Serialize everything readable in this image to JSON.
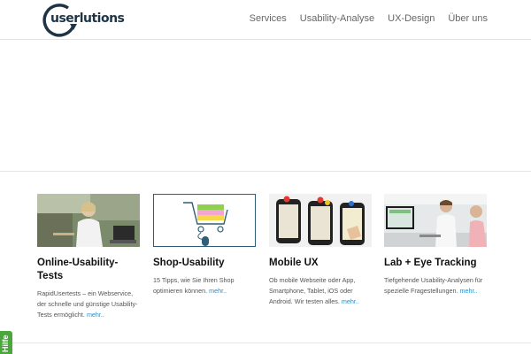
{
  "header": {
    "logo_text": "userlutions",
    "nav": [
      "Services",
      "Usability-Analyse",
      "UX-Design",
      "Über uns"
    ]
  },
  "features": [
    {
      "title": "Online-Usability-Tests",
      "desc": "RapidUsertests – ein Webservice, der schnelle und günstige Usability-Tests ermöglicht.",
      "more": "mehr..",
      "image": "person-with-laptop-outdoors"
    },
    {
      "title": "Shop-Usability",
      "desc": "15 Tipps, wie Sie Ihren Shop optimieren können.",
      "more": "mehr..",
      "image": "shopping-cart-illustration"
    },
    {
      "title": "Mobile UX",
      "desc": "Ob mobile Webseite oder App, Smartphone, Tablet, iOS oder Android. Wir testen alles.",
      "more": "mehr..",
      "image": "smartphone-paper-prototypes"
    },
    {
      "title": "Lab + Eye Tracking",
      "desc": "Tiefgehende Usability-Analysen für spezielle Fragestellungen.",
      "more": "mehr..",
      "image": "eye-tracking-lab-photo"
    }
  ],
  "help_tab": "Hilfe",
  "colors": {
    "accent": "#2a8ec6",
    "logo": "#1d3447",
    "help": "#4aa83a"
  }
}
